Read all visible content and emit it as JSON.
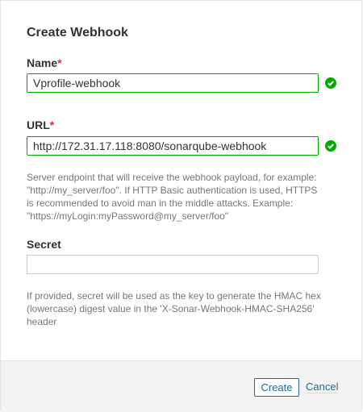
{
  "dialog": {
    "title": "Create Webhook",
    "name": {
      "label": "Name",
      "required_mark": "*",
      "value": "Vprofile-webhook",
      "valid": true
    },
    "url": {
      "label": "URL",
      "required_mark": "*",
      "value": "http://172.31.17.118:8080/sonarqube-webhook",
      "valid": true,
      "help": "Server endpoint that will receive the webhook payload, for example: \"http://my_server/foo\". If HTTP Basic authentication is used, HTTPS is recommended to avoid man in the middle attacks. Example: \"https://myLogin:myPassword@my_server/foo\""
    },
    "secret": {
      "label": "Secret",
      "value": "",
      "help": "If provided, secret will be used as the key to generate the HMAC hex (lowercase) digest value in the 'X-Sonar-Webhook-HMAC-SHA256' header"
    },
    "create_label": "Create",
    "cancel_label": "Cancel"
  },
  "colors": {
    "valid": "#00aa00",
    "accent": "#236a97",
    "required": "#d4333f"
  },
  "icons": {
    "valid": "check-circle-icon"
  }
}
